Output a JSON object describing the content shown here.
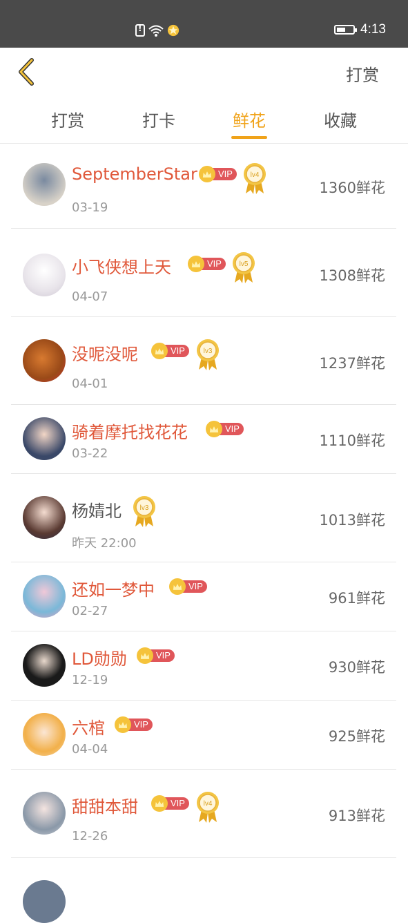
{
  "status_bar": {
    "time": "4:13"
  },
  "header": {
    "right_title": "打赏"
  },
  "tabs": [
    {
      "label": "打赏",
      "active": false
    },
    {
      "label": "打卡",
      "active": false
    },
    {
      "label": "鲜花",
      "active": true
    },
    {
      "label": "收藏",
      "active": false
    }
  ],
  "colors": {
    "accent": "#f0a31a",
    "name": "#e0583a",
    "vip": "#e0565a"
  },
  "rows": [
    {
      "name": "SeptemberStar",
      "date": "03-19",
      "amount": "1360鲜花",
      "vip": "VIP",
      "level": "lv4"
    },
    {
      "name": "小飞侠想上天",
      "date": "04-07",
      "amount": "1308鲜花",
      "vip": "VIP",
      "level": "lv5"
    },
    {
      "name": "没呢没呢",
      "date": "04-01",
      "amount": "1237鲜花",
      "vip": "VIP",
      "level": "lv3"
    },
    {
      "name": "骑着摩托找花花",
      "date": "03-22",
      "amount": "1110鲜花",
      "vip": "VIP"
    },
    {
      "name": "杨婧北",
      "date": "昨天 22:00",
      "amount": "1013鲜花",
      "level": "lv3"
    },
    {
      "name": "还如一梦中",
      "date": "02-27",
      "amount": "961鲜花",
      "vip": "VIP"
    },
    {
      "name": "LD勋勋",
      "date": "12-19",
      "amount": "930鲜花",
      "vip": "VIP"
    },
    {
      "name": "六棺",
      "date": "04-04",
      "amount": "925鲜花",
      "vip": "VIP"
    },
    {
      "name": "甜甜本甜",
      "date": "12-26",
      "amount": "913鲜花",
      "vip": "VIP",
      "level": "lv4"
    }
  ]
}
